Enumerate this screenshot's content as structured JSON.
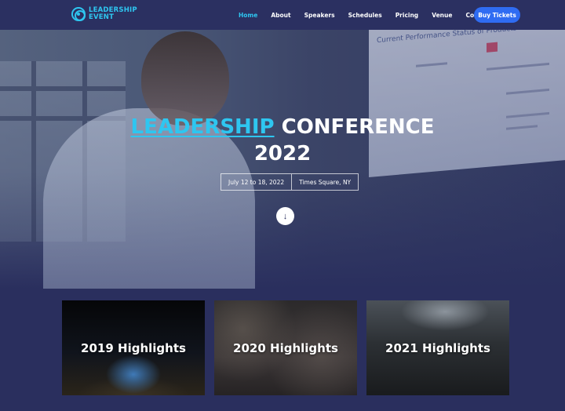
{
  "nav": {
    "logo_line1": "LEADERSHIP",
    "logo_line2": "EVENT",
    "items": [
      {
        "label": "Home",
        "active": true
      },
      {
        "label": "About"
      },
      {
        "label": "Speakers"
      },
      {
        "label": "Schedules"
      },
      {
        "label": "Pricing"
      },
      {
        "label": "Venue"
      },
      {
        "label": "Contact"
      }
    ],
    "cta_label": "Buy Tickets"
  },
  "hero": {
    "title_accent": "LEADERSHIP",
    "title_rest": "CONFERENCE",
    "title_year": "2022",
    "date": "July 12 to 18, 2022",
    "location": "Times Square, NY",
    "scroll_icon": "arrow-down-icon",
    "slide_text": "Current Performance Status of Products"
  },
  "highlights": [
    {
      "label": "2019 Highlights"
    },
    {
      "label": "2020 Highlights"
    },
    {
      "label": "2021 Highlights"
    }
  ],
  "colors": {
    "background": "#2a2f5e",
    "accent": "#2ec6f0",
    "button": "#2f6cf2"
  }
}
